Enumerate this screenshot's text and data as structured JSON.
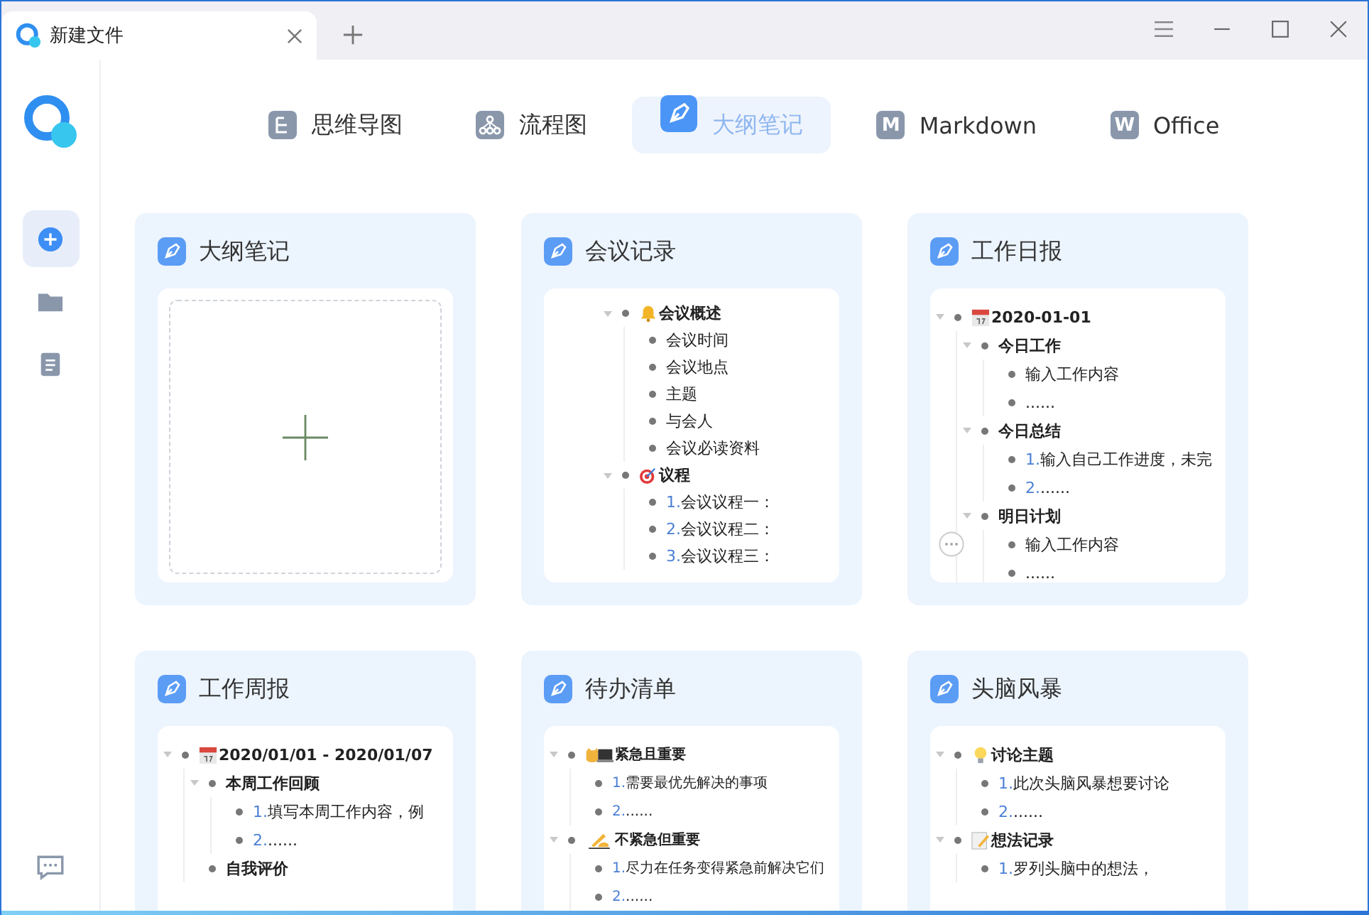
{
  "window": {
    "tab_title": "新建文件"
  },
  "sidebar": {
    "items": [
      {
        "kind": "new",
        "selected": true
      },
      {
        "kind": "folder",
        "selected": false
      },
      {
        "kind": "document",
        "selected": false
      }
    ]
  },
  "modes": [
    {
      "label": "思维导图",
      "kind": "mindmap",
      "selected": false
    },
    {
      "label": "流程图",
      "kind": "flowchart",
      "selected": false
    },
    {
      "label": "大纲笔记",
      "kind": "outline",
      "selected": true
    },
    {
      "label": "Markdown",
      "kind": "letter",
      "letter": "M",
      "selected": false
    },
    {
      "label": "Office",
      "kind": "letter",
      "letter": "W",
      "selected": false
    }
  ],
  "templates": [
    {
      "title": "大纲笔记",
      "kind": "blank"
    },
    {
      "title": "会议记录",
      "kind": "outline",
      "indent": true,
      "nodes": [
        {
          "text": "会议概述",
          "kind": "bell",
          "bold": true,
          "children": [
            {
              "text": "会议时间"
            },
            {
              "text": "会议地点"
            },
            {
              "text": "主题"
            },
            {
              "text": "与会人"
            },
            {
              "text": "会议必读资料"
            }
          ]
        },
        {
          "text": "议程",
          "kind": "target",
          "bold": true,
          "children": [
            {
              "number": "1.",
              "text": "会议议程一："
            },
            {
              "number": "2.",
              "text": "会议议程二："
            },
            {
              "number": "3.",
              "text": "会议议程三："
            }
          ]
        }
      ]
    },
    {
      "title": "工作日报",
      "kind": "outline",
      "indent": false,
      "nodes": [
        {
          "text": "2020-01-01",
          "kind": "calendar",
          "bold": true,
          "children": [
            {
              "text": "今日工作",
              "bold": true,
              "children": [
                {
                  "text": "输入工作内容"
                },
                {
                  "text": "......"
                }
              ]
            },
            {
              "text": "今日总结",
              "bold": true,
              "children": [
                {
                  "number": "1.",
                  "text": "输入自己工作进度，未完"
                },
                {
                  "number": "2.",
                  "text": "......"
                }
              ]
            },
            {
              "text": "明日计划",
              "bold": true,
              "children": [
                {
                  "text": "输入工作内容",
                  "handle": true
                },
                {
                  "text": "......"
                }
              ]
            }
          ]
        }
      ]
    },
    {
      "title": "工作周报",
      "kind": "outline",
      "indent": false,
      "nodes": [
        {
          "text": "2020/01/01 - 2020/01/07",
          "kind": "calendar",
          "bold": true,
          "children": [
            {
              "text": "本周工作回顾",
              "bold": true,
              "children": [
                {
                  "number": "1.",
                  "text": "填写本周工作内容，例"
                },
                {
                  "number": "2.",
                  "text": "......"
                }
              ]
            },
            {
              "text": "自我评价",
              "bold": true
            }
          ]
        }
      ]
    },
    {
      "title": "待办清单",
      "kind": "outline",
      "indent": false,
      "small": true,
      "nodes": [
        {
          "text": "紧急且重要",
          "kind": "cat-laptop",
          "bold": true,
          "children": [
            {
              "number": "1.",
              "text": "需要最优先解决的事项"
            },
            {
              "number": "2.",
              "text": "......"
            }
          ]
        },
        {
          "text": "不紧急但重要",
          "kind": "writing-hand",
          "bold": true,
          "children": [
            {
              "number": "1.",
              "text": "尽力在任务变得紧急前解决它们"
            },
            {
              "number": "2.",
              "text": "......"
            }
          ]
        }
      ]
    },
    {
      "title": "头脑风暴",
      "kind": "outline",
      "indent": false,
      "nodes": [
        {
          "text": "讨论主题",
          "kind": "bulb",
          "bold": true,
          "children": [
            {
              "number": "1.",
              "text": "此次头脑风暴想要讨论"
            },
            {
              "number": "2.",
              "text": "......"
            }
          ]
        },
        {
          "text": "想法记录",
          "kind": "memo",
          "bold": true,
          "children": [
            {
              "number": "1.",
              "text": "罗列头脑中的想法，"
            }
          ]
        }
      ]
    }
  ]
}
